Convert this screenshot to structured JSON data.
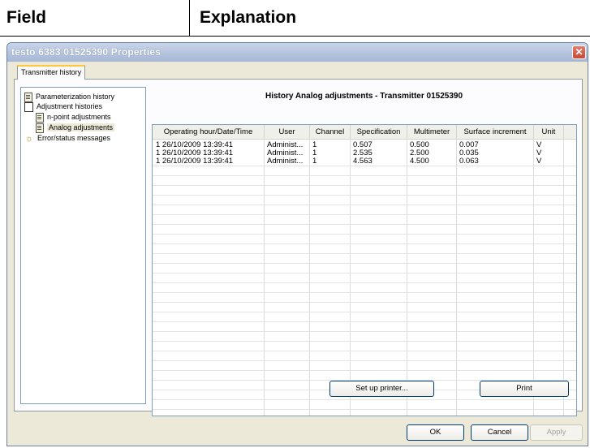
{
  "doc_table": {
    "col1": "Field",
    "col2": "Explanation"
  },
  "window": {
    "title": "testo 6383  01525390 Properties",
    "close_glyph": "✕"
  },
  "tab": {
    "label": "Transmitter history"
  },
  "tree": {
    "items": [
      {
        "label": "Parameterization history"
      },
      {
        "label": "Adjustment histories"
      },
      {
        "label": "n-point adjustments"
      },
      {
        "label": "Analog adjustments"
      },
      {
        "label": "Error/status messages"
      }
    ]
  },
  "panel": {
    "title": "History Analog adjustments - Transmitter 01525390"
  },
  "table": {
    "headers": [
      "Operating hour/Date/Time",
      "User",
      "Channel",
      "Specification",
      "Multimeter",
      "Surface increment",
      "Unit"
    ],
    "rows": [
      [
        "1 26/10/2009 13:39:41",
        "Administ...",
        "1",
        "0.507",
        "0.500",
        "0.007",
        "V"
      ],
      [
        "1 26/10/2009 13:39:41",
        "Administ...",
        "1",
        "2.535",
        "2.500",
        "0.035",
        "V"
      ],
      [
        "1 26/10/2009 13:39:41",
        "Administ...",
        "1",
        "4.563",
        "4.500",
        "0.063",
        "V"
      ]
    ]
  },
  "buttons": {
    "setup_printer": "Set up printer...",
    "print": "Print",
    "ok": "OK",
    "cancel": "Cancel",
    "apply": "Apply"
  }
}
